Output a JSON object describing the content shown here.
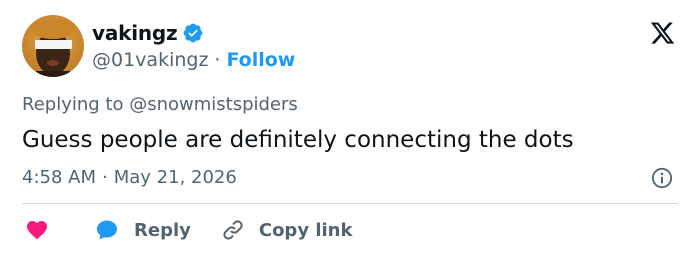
{
  "author": {
    "display_name": "vakingz",
    "handle": "@01vakingz",
    "separator": "·",
    "follow_label": "Follow",
    "verified": true,
    "avatar_icon": "profile-photo"
  },
  "reply_context": "Replying to @snowmistspiders",
  "tweet_text": "Guess people are definitely connecting the dots",
  "meta": {
    "time": "4:58 AM",
    "separator": "·",
    "date": "May 21, 2026"
  },
  "actions": {
    "like_icon": "heart-icon",
    "reply_label": "Reply",
    "reply_icon": "speech-bubble-icon",
    "copy_label": "Copy link",
    "copy_icon": "link-icon"
  },
  "colors": {
    "accent": "#1d9bf0",
    "like": "#f91880",
    "secondary_text": "#536471",
    "primary_text": "#0f1419",
    "divider": "#cfd9de"
  }
}
